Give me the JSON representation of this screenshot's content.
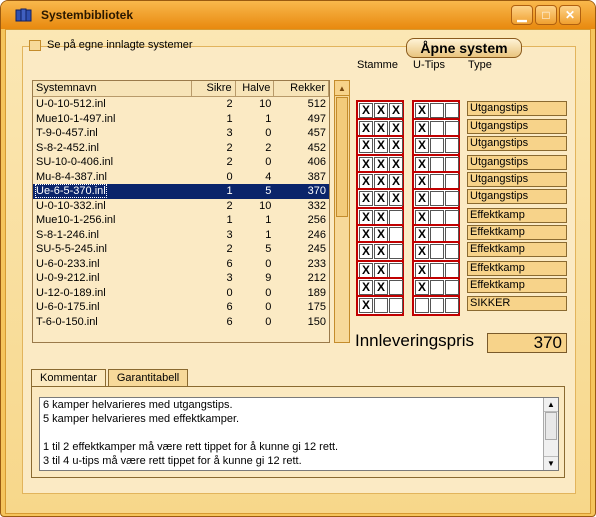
{
  "title": "Systembibliotek",
  "controls": {
    "minimize": "▁",
    "maximize": "□",
    "close": "✕"
  },
  "options": {
    "own_systems_label": "Se på egne innlagte systemer"
  },
  "buttons": {
    "open_system": "Åpne system"
  },
  "list": {
    "headers": [
      "Systemnavn",
      "Sikre",
      "Halve",
      "Rekker"
    ],
    "rows": [
      {
        "name": "U-0-10-512.inl",
        "sikre": "2",
        "halve": "10",
        "rekker": "512"
      },
      {
        "name": "Mue10-1-497.inl",
        "sikre": "1",
        "halve": "1",
        "rekker": "497"
      },
      {
        "name": "T-9-0-457.inl",
        "sikre": "3",
        "halve": "0",
        "rekker": "457"
      },
      {
        "name": "S-8-2-452.inl",
        "sikre": "2",
        "halve": "2",
        "rekker": "452"
      },
      {
        "name": "SU-10-0-406.inl",
        "sikre": "2",
        "halve": "0",
        "rekker": "406"
      },
      {
        "name": "Mu-8-4-387.inl",
        "sikre": "0",
        "halve": "4",
        "rekker": "387"
      },
      {
        "name": "Ue-6-5-370.inl",
        "sikre": "1",
        "halve": "5",
        "rekker": "370",
        "selected": true
      },
      {
        "name": "U-0-10-332.inl",
        "sikre": "2",
        "halve": "10",
        "rekker": "332"
      },
      {
        "name": "Mue10-1-256.inl",
        "sikre": "1",
        "halve": "1",
        "rekker": "256"
      },
      {
        "name": "S-8-1-246.inl",
        "sikre": "3",
        "halve": "1",
        "rekker": "246"
      },
      {
        "name": "SU-5-5-245.inl",
        "sikre": "2",
        "halve": "5",
        "rekker": "245"
      },
      {
        "name": "U-6-0-233.inl",
        "sikre": "6",
        "halve": "0",
        "rekker": "233"
      },
      {
        "name": "U-0-9-212.inl",
        "sikre": "3",
        "halve": "9",
        "rekker": "212"
      },
      {
        "name": "U-12-0-189.inl",
        "sikre": "0",
        "halve": "0",
        "rekker": "189"
      },
      {
        "name": "U-6-0-175.inl",
        "sikre": "6",
        "halve": "0",
        "rekker": "175"
      },
      {
        "name": "T-6-0-150.inl",
        "sikre": "6",
        "halve": "0",
        "rekker": "150"
      }
    ]
  },
  "matrix": {
    "headers": {
      "stamme": "Stamme",
      "utips": "U-Tips",
      "type": "Type"
    },
    "rows": [
      {
        "stamme": [
          "X",
          "X",
          "X"
        ],
        "utips": [
          "X",
          "",
          ""
        ],
        "type": "Utgangstips"
      },
      {
        "stamme": [
          "X",
          "X",
          "X"
        ],
        "utips": [
          "X",
          "",
          ""
        ],
        "type": "Utgangstips"
      },
      {
        "stamme": [
          "X",
          "X",
          "X"
        ],
        "utips": [
          "X",
          "",
          ""
        ],
        "type": "Utgangstips"
      },
      {
        "stamme": [
          "X",
          "X",
          "X"
        ],
        "utips": [
          "X",
          "",
          ""
        ],
        "type": "Utgangstips"
      },
      {
        "stamme": [
          "X",
          "X",
          "X"
        ],
        "utips": [
          "X",
          "",
          ""
        ],
        "type": "Utgangstips"
      },
      {
        "stamme": [
          "X",
          "X",
          "X"
        ],
        "utips": [
          "X",
          "",
          ""
        ],
        "type": "Utgangstips"
      },
      {
        "stamme": [
          "X",
          "X",
          ""
        ],
        "utips": [
          "X",
          "",
          ""
        ],
        "type": "Effektkamp"
      },
      {
        "stamme": [
          "X",
          "X",
          ""
        ],
        "utips": [
          "X",
          "",
          ""
        ],
        "type": "Effektkamp"
      },
      {
        "stamme": [
          "X",
          "X",
          ""
        ],
        "utips": [
          "X",
          "",
          ""
        ],
        "type": "Effektkamp"
      },
      {
        "stamme": [
          "X",
          "X",
          ""
        ],
        "utips": [
          "X",
          "",
          ""
        ],
        "type": "Effektkamp"
      },
      {
        "stamme": [
          "X",
          "X",
          ""
        ],
        "utips": [
          "X",
          "",
          ""
        ],
        "type": "Effektkamp"
      },
      {
        "stamme": [
          "X",
          "",
          ""
        ],
        "utips": [
          "",
          "",
          ""
        ],
        "type": "SIKKER"
      }
    ]
  },
  "innlevering": {
    "label": "Innleveringspris",
    "value": "370"
  },
  "tabs": [
    "Kommentar",
    "Garantitabell"
  ],
  "comment": [
    "6 kamper helvarieres med utgangstips.",
    "5 kamper helvarieres med effektkamper.",
    "",
    "1 til 2 effektkamper må være rett tippet for å kunne gi 12 rett.",
    "3 til 4 u-tips må være rett tippet for å kunne gi 12 rett."
  ],
  "colors": {
    "accent": "#f5c45c",
    "selection": "#0a246a",
    "box_border": "#c00000"
  }
}
